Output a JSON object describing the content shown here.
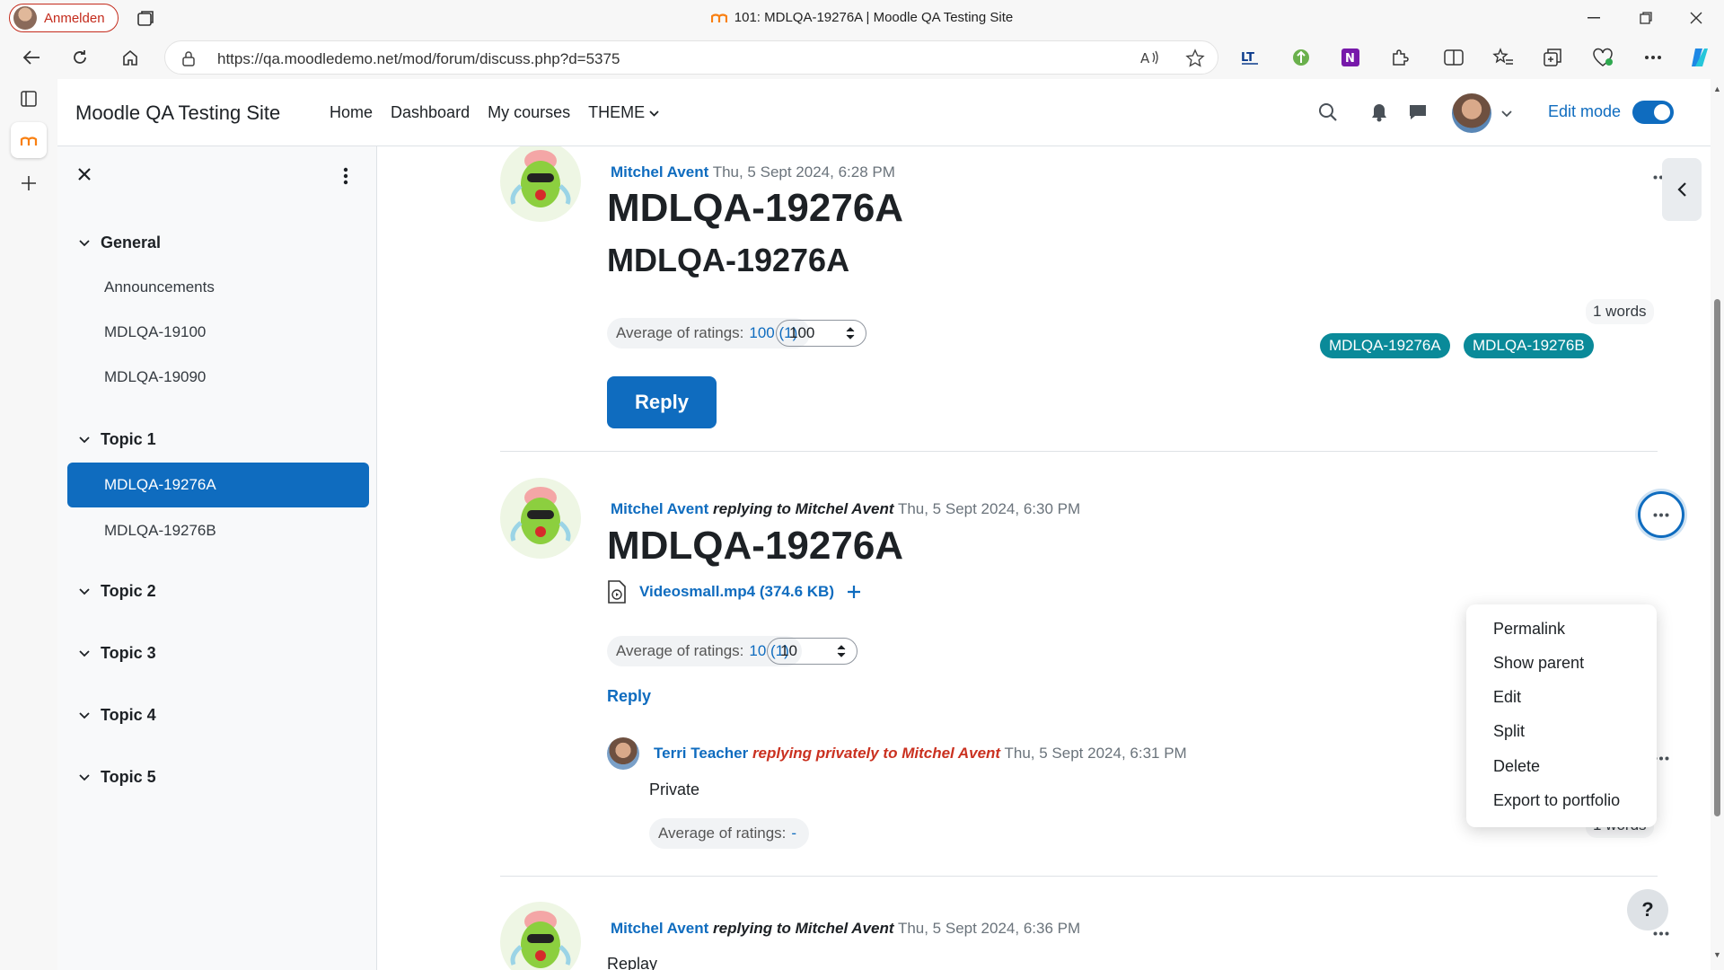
{
  "browser": {
    "profile_label": "Anmelden",
    "window_title": "101: MDLQA-19276A | Moodle QA Testing Site",
    "url": "https://qa.moodledemo.net/mod/forum/discuss.php?d=5375"
  },
  "site": {
    "name": "Moodle QA Testing Site",
    "nav": [
      "Home",
      "Dashboard",
      "My courses",
      "THEME"
    ],
    "edit_mode_label": "Edit mode"
  },
  "drawer": {
    "sections": [
      {
        "label": "General",
        "items": [
          "Announcements",
          "MDLQA-19100",
          "MDLQA-19090"
        ]
      },
      {
        "label": "Topic 1",
        "items": [
          "MDLQA-19276A",
          "MDLQA-19276B"
        ],
        "active": "MDLQA-19276A"
      },
      {
        "label": "Topic 2",
        "items": []
      },
      {
        "label": "Topic 3",
        "items": []
      },
      {
        "label": "Topic 4",
        "items": []
      },
      {
        "label": "Topic 5",
        "items": []
      }
    ]
  },
  "posts": [
    {
      "author": "Mitchel Avent",
      "date": "Thu, 5 Sept 2024, 6:28 PM",
      "subject": "MDLQA-19276A",
      "body": "MDLQA-19276A",
      "rating_label": "Average of ratings:",
      "rating_value": "100 (1)",
      "rating_select": "100",
      "words": "1 words",
      "tags": [
        "MDLQA-19276A",
        "MDLQA-19276B"
      ],
      "reply_label": "Reply"
    },
    {
      "author": "Mitchel Avent",
      "replying": "replying to Mitchel Avent",
      "date": "Thu, 5 Sept 2024, 6:30 PM",
      "subject": "MDLQA-19276A",
      "attachment": "Videosmall.mp4 (374.6 KB)",
      "rating_label": "Average of ratings:",
      "rating_value": "10 (1)",
      "rating_select": "10",
      "reply_label": "Reply"
    },
    {
      "author": "Terri Teacher",
      "replying": "replying privately to Mitchel Avent",
      "date": "Thu, 5 Sept 2024, 6:31 PM",
      "body": "Private",
      "rating_label": "Average of ratings:",
      "rating_value": "-",
      "words": "1 words"
    },
    {
      "author": "Mitchel Avent",
      "replying": "replying to Mitchel Avent",
      "date": "Thu, 5 Sept 2024, 6:36 PM",
      "body": "Replay"
    }
  ],
  "menu": {
    "items": [
      "Permalink",
      "Show parent",
      "Edit",
      "Split",
      "Delete",
      "Export to portfolio"
    ]
  },
  "help_label": "?",
  "colors": {
    "brand": "#0f6cbf",
    "tag": "#0a8a99",
    "private": "#ca3120"
  },
  "icons": [
    "search-icon",
    "bell-icon",
    "chat-icon",
    "chevron-down-icon",
    "ellipsis-icon",
    "close-icon",
    "kebab-icon",
    "file-video-icon",
    "plus-icon",
    "chevron-left-icon",
    "help-icon"
  ]
}
